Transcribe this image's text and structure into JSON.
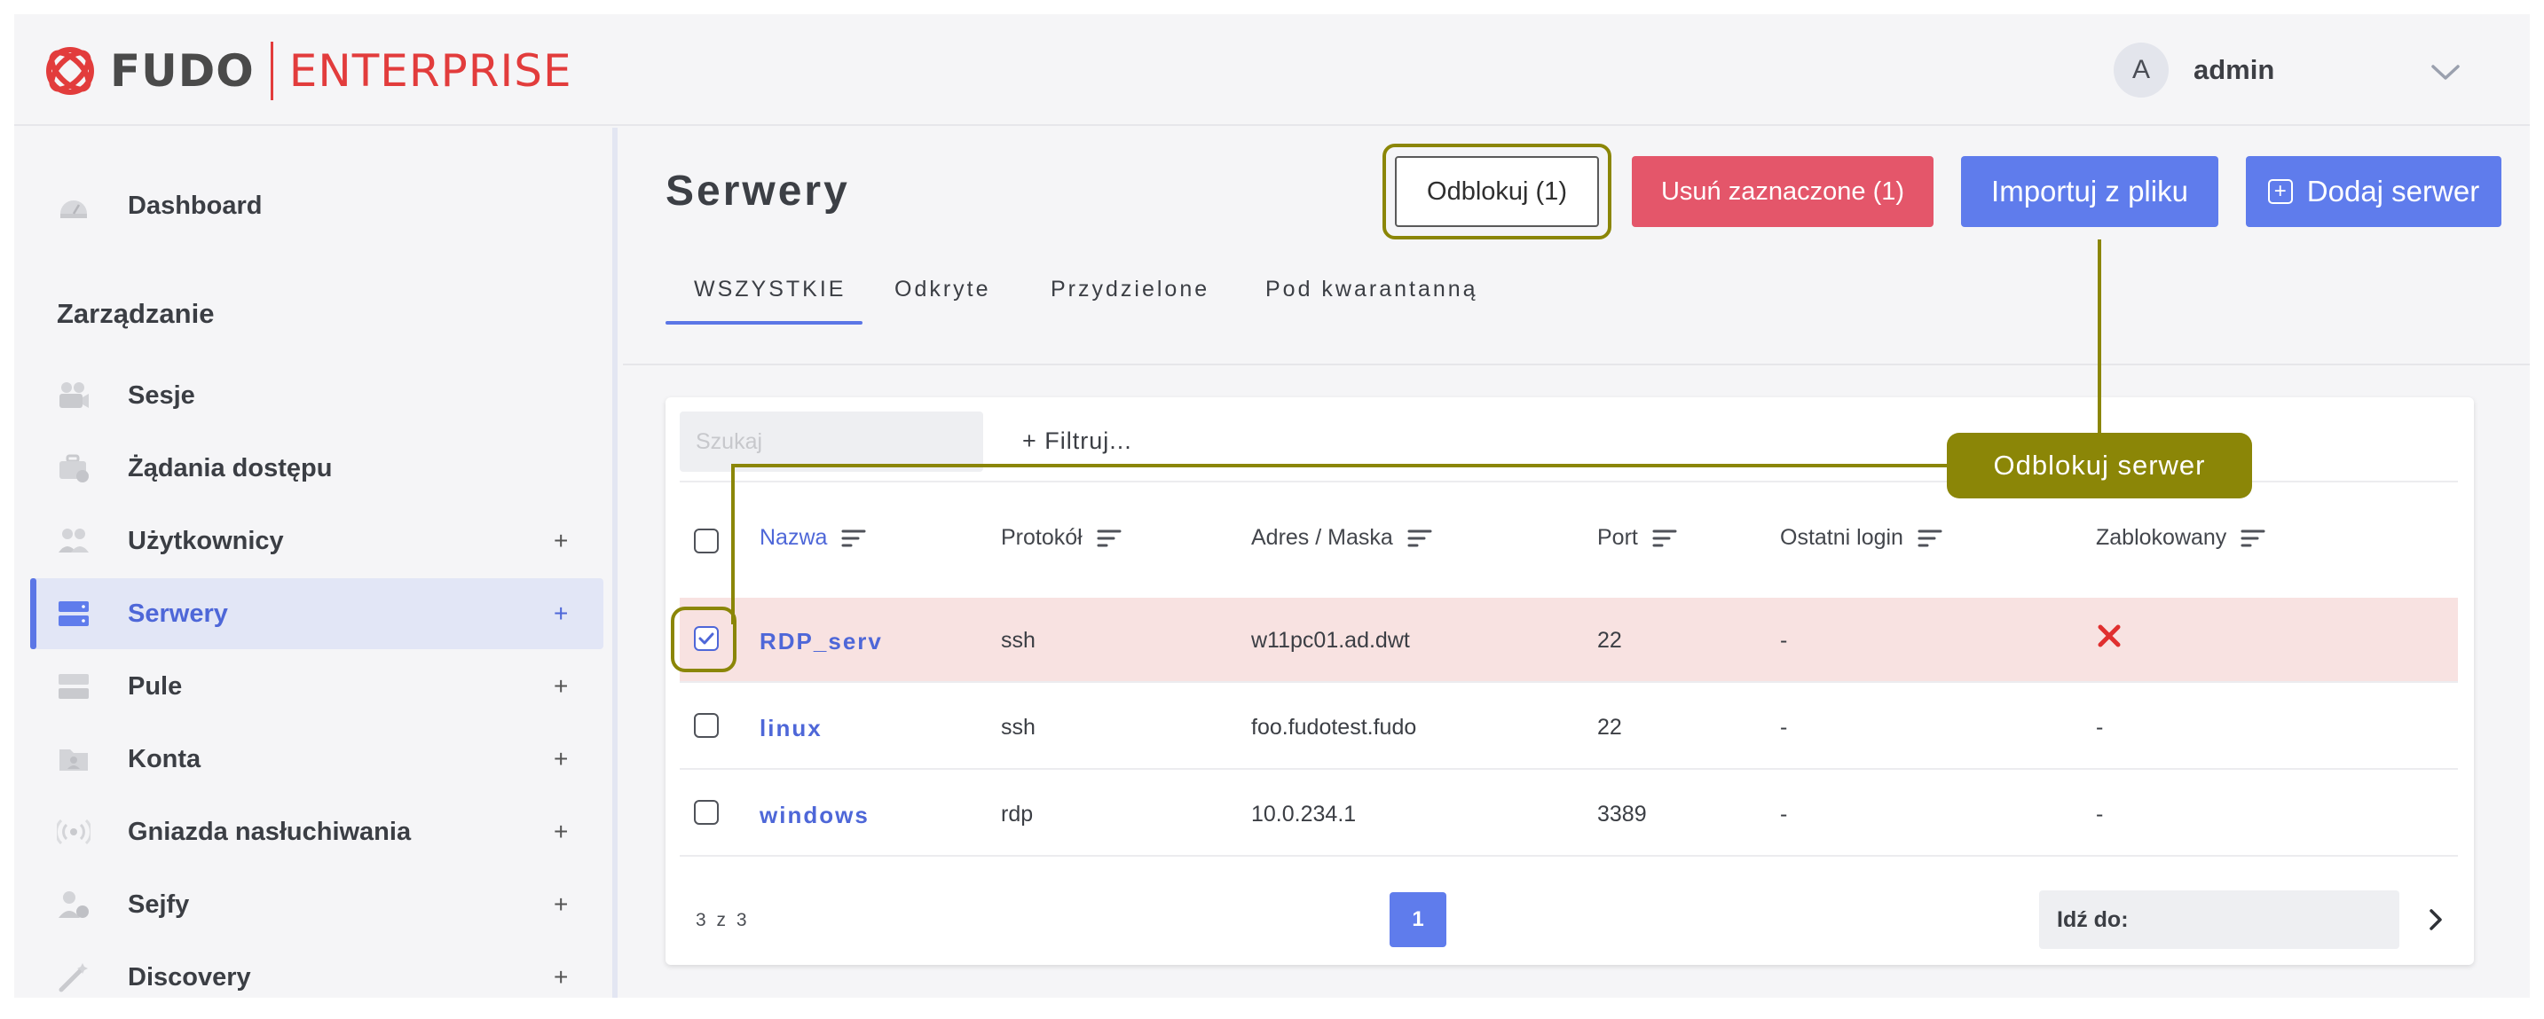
{
  "app": {
    "brand_primary": "FUDO",
    "brand_secondary": "ENTERPRISE",
    "brand_color": "#e23c3c",
    "accent_color": "#5f7cec"
  },
  "user": {
    "avatar_letter": "A",
    "name": "admin"
  },
  "sidebar": {
    "dashboard_label": "Dashboard",
    "section_title": "Zarządzanie",
    "items": [
      {
        "label": "Sesje",
        "icon": "camera-icon",
        "expandable": false
      },
      {
        "label": "Żądania dostępu",
        "icon": "briefcase-icon",
        "expandable": false
      },
      {
        "label": "Użytkownicy",
        "icon": "users-icon",
        "expandable": true
      },
      {
        "label": "Serwery",
        "icon": "server-icon",
        "expandable": true,
        "active": true
      },
      {
        "label": "Pule",
        "icon": "pool-icon",
        "expandable": true
      },
      {
        "label": "Konta",
        "icon": "account-folder-icon",
        "expandable": true
      },
      {
        "label": "Gniazda nasłuchiwania",
        "icon": "broadcast-icon",
        "expandable": true
      },
      {
        "label": "Sejfy",
        "icon": "safe-user-icon",
        "expandable": true
      },
      {
        "label": "Discovery",
        "icon": "magic-wand-icon",
        "expandable": true
      }
    ],
    "plus": "+"
  },
  "main": {
    "title": "Serwery",
    "buttons": {
      "unlock": "Odblokuj (1)",
      "delete": "Usuń zaznaczone (1)",
      "import": "Importuj z pliku",
      "add": "Dodaj serwer"
    },
    "tabs": [
      "WSZYSTKIE",
      "Odkryte",
      "Przydzielone",
      "Pod kwarantanną"
    ],
    "active_tab": 0,
    "search_placeholder": "Szukaj",
    "filter_label": "+ Filtruj...",
    "columns": [
      "Nazwa",
      "Protokół",
      "Adres / Maska",
      "Port",
      "Ostatni login",
      "Zablokowany"
    ],
    "rows": [
      {
        "name": "RDP_serv",
        "protocol": "ssh",
        "address": "w11pc01.ad.dwt",
        "port": "22",
        "last_login": "-",
        "blocked": "x",
        "selected": true
      },
      {
        "name": "linux",
        "protocol": "ssh",
        "address": "foo.fudotest.fudo",
        "port": "22",
        "last_login": "-",
        "blocked": "-",
        "selected": false
      },
      {
        "name": "windows",
        "protocol": "rdp",
        "address": "10.0.234.1",
        "port": "3389",
        "last_login": "-",
        "blocked": "-",
        "selected": false
      }
    ],
    "count_text": "3 z 3",
    "current_page": "1",
    "goto_label": "Idź do:"
  },
  "callout": {
    "text": "Odblokuj serwer",
    "color": "#8b8607"
  }
}
